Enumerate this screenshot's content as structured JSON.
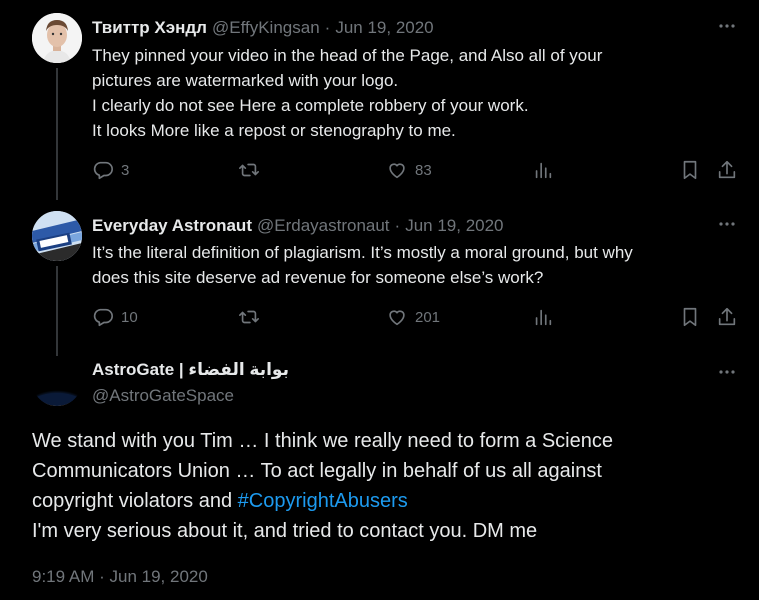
{
  "tweets": [
    {
      "author": "Твиттр Хэндл",
      "handle": "@EffyKingsan",
      "sep": "·",
      "date": "Jun 19, 2020",
      "lines": [
        "They pinned your video in the head of the Page, and Also all of your",
        "pictures are watermarked with your logo.",
        "I clearly do not see Here a complete robbery of your work.",
        "It looks More like a repost or stenography to me."
      ],
      "replies": "3",
      "likes": "83"
    },
    {
      "author": "Everyday Astronaut",
      "handle": "@Erdayastronaut",
      "sep": "·",
      "date": "Jun 19, 2020",
      "lines": [
        "It’s the literal definition of plagiarism. It’s mostly a moral ground, but why",
        "does this site deserve ad revenue for someone else’s work?"
      ],
      "replies": "10",
      "likes": "201"
    }
  ],
  "main_tweet": {
    "author": "AstroGate | بوابة الفضاء",
    "handle": "@AstroGateSpace",
    "line1": "We stand with you Tim … I think we really need to form a Science",
    "line2": "Communicators Union … To act legally in behalf of us all against",
    "line3_prefix": "copyright violators and ",
    "hashtag": "#CopyrightAbusers",
    "line4": "I'm very serious about it, and tried to contact you. DM me",
    "time": "9:19 AM",
    "sep": "·",
    "date": "Jun 19, 2020"
  },
  "colors": {
    "background": "#000000",
    "text": "#e7e9ea",
    "muted": "#71767b",
    "link": "#1d9bf0"
  },
  "icons": [
    "reply-icon",
    "retweet-icon",
    "like-icon",
    "views-icon",
    "bookmark-icon",
    "share-icon",
    "more-icon"
  ]
}
